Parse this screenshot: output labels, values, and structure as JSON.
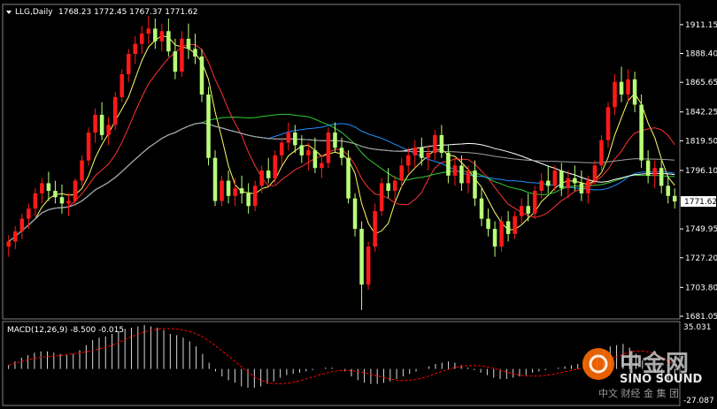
{
  "header": {
    "symbol": "LLG,Daily",
    "ohlc": "1768.23 1772.45 1767.37 1771.62"
  },
  "macd": {
    "label": "MACD(12,26,9) -8.500 -0.015",
    "max_label": "35.031",
    "min_label": "-27.087"
  },
  "watermark": {
    "cn": "中金网",
    "en": "SINO SOUND",
    "sub": "中文 财经 金 集 团"
  },
  "colors": {
    "background": "#000000",
    "up_candle": "#ff1a1a",
    "down_candle": "#b8ff78",
    "ma_yellow": "#ffff66",
    "ma_red": "#ff3333",
    "ma_green": "#33cc33",
    "ma_blue": "#1e90ff",
    "ma_white": "#ffffff",
    "ma_gray": "#a0a0a0",
    "macd_hist": "#d9d9d9",
    "macd_signal": "#ff0000",
    "current_price_bg": "#ffffff"
  },
  "chart_data": {
    "type": "candlestick",
    "y_ticks": [
      "1911.15",
      "1888.40",
      "1865.65",
      "1842.25",
      "1819.50",
      "1796.10",
      "1771.62",
      "1749.95",
      "1727.20",
      "1703.80",
      "1681.05"
    ],
    "current_price": "1771.62",
    "ylim": [
      1681.05,
      1925.0
    ],
    "ohlc": [
      [
        1736,
        1745,
        1728,
        1740
      ],
      [
        1740,
        1752,
        1734,
        1748
      ],
      [
        1748,
        1762,
        1742,
        1758
      ],
      [
        1758,
        1770,
        1750,
        1766
      ],
      [
        1766,
        1782,
        1760,
        1778
      ],
      [
        1778,
        1790,
        1770,
        1786
      ],
      [
        1786,
        1795,
        1772,
        1780
      ],
      [
        1780,
        1788,
        1770,
        1775
      ],
      [
        1775,
        1785,
        1762,
        1770
      ],
      [
        1770,
        1778,
        1760,
        1772
      ],
      [
        1772,
        1790,
        1768,
        1788
      ],
      [
        1788,
        1808,
        1784,
        1804
      ],
      [
        1804,
        1830,
        1800,
        1826
      ],
      [
        1826,
        1845,
        1818,
        1840
      ],
      [
        1840,
        1850,
        1820,
        1824
      ],
      [
        1824,
        1838,
        1816,
        1832
      ],
      [
        1832,
        1858,
        1828,
        1854
      ],
      [
        1854,
        1876,
        1850,
        1872
      ],
      [
        1872,
        1892,
        1866,
        1888
      ],
      [
        1888,
        1902,
        1880,
        1896
      ],
      [
        1896,
        1910,
        1888,
        1904
      ],
      [
        1904,
        1918,
        1896,
        1908
      ],
      [
        1908,
        1916,
        1892,
        1898
      ],
      [
        1898,
        1912,
        1890,
        1906
      ],
      [
        1906,
        1916,
        1886,
        1890
      ],
      [
        1890,
        1900,
        1868,
        1874
      ],
      [
        1874,
        1906,
        1870,
        1900
      ],
      [
        1900,
        1912,
        1884,
        1892
      ],
      [
        1892,
        1904,
        1880,
        1886
      ],
      [
        1886,
        1892,
        1850,
        1856
      ],
      [
        1856,
        1862,
        1800,
        1806
      ],
      [
        1806,
        1812,
        1768,
        1772
      ],
      [
        1772,
        1792,
        1768,
        1788
      ],
      [
        1788,
        1796,
        1770,
        1776
      ],
      [
        1776,
        1790,
        1768,
        1782
      ],
      [
        1782,
        1792,
        1770,
        1778
      ],
      [
        1778,
        1786,
        1762,
        1768
      ],
      [
        1768,
        1788,
        1764,
        1784
      ],
      [
        1784,
        1800,
        1778,
        1796
      ],
      [
        1796,
        1806,
        1786,
        1790
      ],
      [
        1790,
        1812,
        1786,
        1808
      ],
      [
        1808,
        1822,
        1800,
        1818
      ],
      [
        1818,
        1834,
        1812,
        1826
      ],
      [
        1826,
        1832,
        1810,
        1816
      ],
      [
        1816,
        1824,
        1802,
        1808
      ],
      [
        1808,
        1818,
        1796,
        1812
      ],
      [
        1812,
        1822,
        1794,
        1798
      ],
      [
        1798,
        1808,
        1790,
        1802
      ],
      [
        1802,
        1830,
        1798,
        1826
      ],
      [
        1826,
        1834,
        1810,
        1814
      ],
      [
        1814,
        1822,
        1800,
        1806
      ],
      [
        1806,
        1812,
        1770,
        1774
      ],
      [
        1774,
        1778,
        1744,
        1750
      ],
      [
        1750,
        1756,
        1686,
        1706
      ],
      [
        1706,
        1740,
        1702,
        1736
      ],
      [
        1736,
        1770,
        1732,
        1764
      ],
      [
        1764,
        1790,
        1760,
        1786
      ],
      [
        1786,
        1798,
        1774,
        1780
      ],
      [
        1780,
        1792,
        1772,
        1788
      ],
      [
        1788,
        1806,
        1782,
        1800
      ],
      [
        1800,
        1814,
        1794,
        1808
      ],
      [
        1808,
        1820,
        1798,
        1814
      ],
      [
        1814,
        1822,
        1800,
        1806
      ],
      [
        1806,
        1816,
        1796,
        1810
      ],
      [
        1810,
        1828,
        1804,
        1824
      ],
      [
        1824,
        1832,
        1806,
        1810
      ],
      [
        1810,
        1816,
        1786,
        1792
      ],
      [
        1792,
        1806,
        1784,
        1800
      ],
      [
        1800,
        1808,
        1780,
        1786
      ],
      [
        1786,
        1800,
        1778,
        1796
      ],
      [
        1796,
        1804,
        1768,
        1774
      ],
      [
        1774,
        1782,
        1752,
        1758
      ],
      [
        1758,
        1766,
        1744,
        1750
      ],
      [
        1750,
        1756,
        1728,
        1736
      ],
      [
        1736,
        1760,
        1732,
        1756
      ],
      [
        1756,
        1764,
        1740,
        1746
      ],
      [
        1746,
        1764,
        1742,
        1760
      ],
      [
        1760,
        1774,
        1754,
        1768
      ],
      [
        1768,
        1778,
        1756,
        1762
      ],
      [
        1762,
        1784,
        1758,
        1780
      ],
      [
        1780,
        1794,
        1774,
        1788
      ],
      [
        1788,
        1800,
        1778,
        1784
      ],
      [
        1784,
        1800,
        1780,
        1796
      ],
      [
        1796,
        1802,
        1776,
        1782
      ],
      [
        1782,
        1796,
        1774,
        1790
      ],
      [
        1790,
        1800,
        1780,
        1786
      ],
      [
        1786,
        1796,
        1772,
        1778
      ],
      [
        1778,
        1792,
        1770,
        1788
      ],
      [
        1788,
        1804,
        1784,
        1800
      ],
      [
        1800,
        1824,
        1796,
        1820
      ],
      [
        1820,
        1850,
        1814,
        1846
      ],
      [
        1846,
        1872,
        1840,
        1866
      ],
      [
        1866,
        1878,
        1850,
        1856
      ],
      [
        1856,
        1876,
        1850,
        1868
      ],
      [
        1868,
        1874,
        1842,
        1848
      ],
      [
        1848,
        1856,
        1798,
        1804
      ],
      [
        1804,
        1812,
        1786,
        1792
      ],
      [
        1792,
        1804,
        1782,
        1798
      ],
      [
        1798,
        1804,
        1778,
        1784
      ],
      [
        1784,
        1792,
        1770,
        1776
      ],
      [
        1776,
        1782,
        1766,
        1771.62
      ]
    ],
    "macd_hist": [
      3,
      6,
      9,
      11,
      13,
      14,
      14,
      13,
      12,
      11,
      12,
      15,
      19,
      23,
      25,
      26,
      28,
      30,
      32,
      33,
      34,
      35,
      34,
      33,
      31,
      28,
      27,
      25,
      22,
      18,
      12,
      5,
      -2,
      -6,
      -9,
      -11,
      -14,
      -15,
      -15,
      -14,
      -12,
      -10,
      -7,
      -5,
      -4,
      -3,
      -2,
      -1,
      0,
      1,
      1,
      0,
      -2,
      -6,
      -9,
      -11,
      -12,
      -12,
      -11,
      -10,
      -8,
      -6,
      -4,
      -2,
      0,
      2,
      4,
      5,
      6,
      5,
      3,
      1,
      -1,
      -3,
      -5,
      -7,
      -8,
      -8,
      -7,
      -6,
      -5,
      -3,
      -2,
      -1,
      0,
      1,
      2,
      3,
      4,
      6,
      9,
      12,
      15,
      18,
      19,
      20,
      17,
      12,
      7,
      2,
      -3,
      -8,
      -10,
      -8.5
    ],
    "macd_signal_label": "signal"
  }
}
